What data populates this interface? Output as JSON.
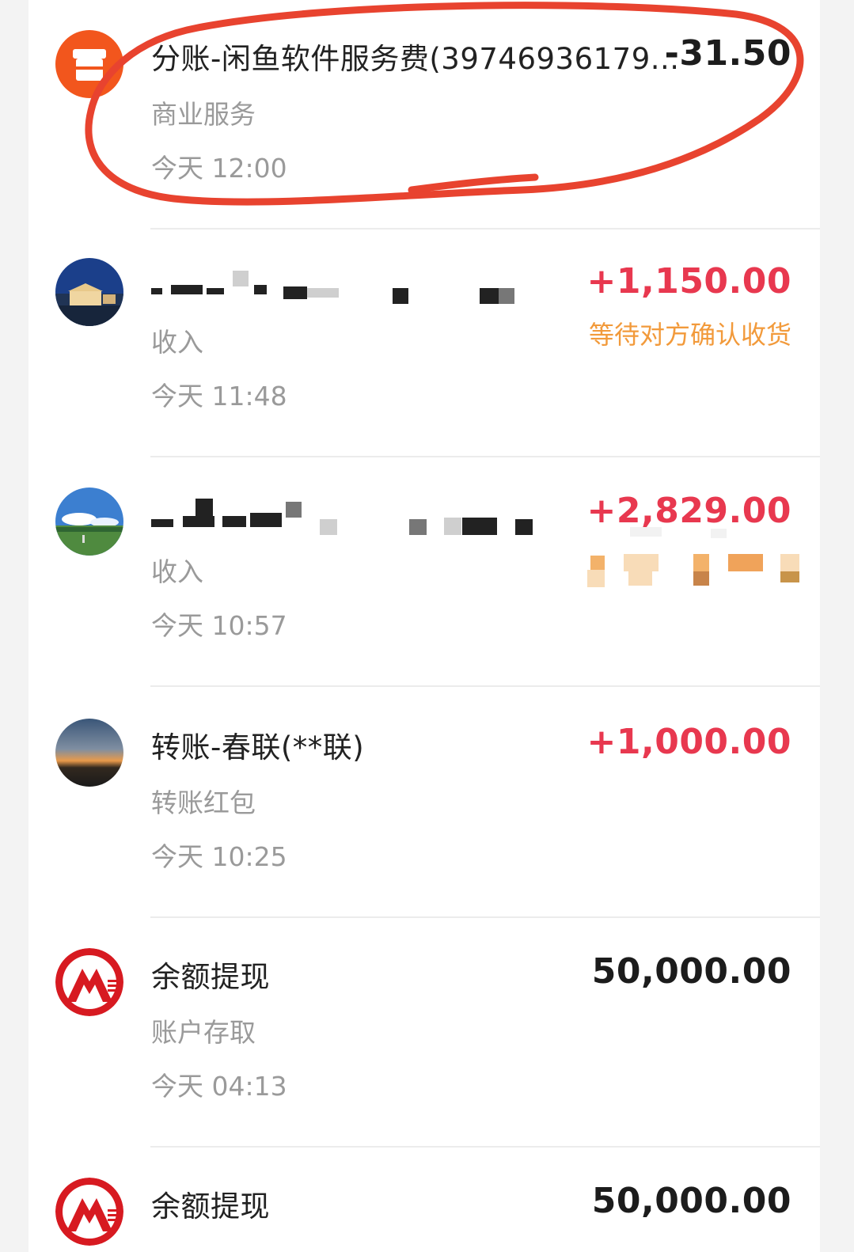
{
  "transactions": [
    {
      "title": "分账-闲鱼软件服务费(39746936179...",
      "category": "商业服务",
      "time": "今天 12:00",
      "amount": "-31.50",
      "icon": "store-icon",
      "status": ""
    },
    {
      "title": "",
      "category": "收入",
      "time": "今天 11:48",
      "amount": "+1,150.00",
      "icon": "avatar-building-night",
      "status": "等待对方确认收货"
    },
    {
      "title": "",
      "category": "收入",
      "time": "今天 10:57",
      "amount": "+2,829.00",
      "icon": "avatar-field-sky",
      "status": ""
    },
    {
      "title": "转账-春联(**联)",
      "category": "转账红包",
      "time": "今天 10:25",
      "amount": "+1,000.00",
      "icon": "avatar-sunset",
      "status": ""
    },
    {
      "title": "余额提现",
      "category": "账户存取",
      "time": "今天 04:13",
      "amount": "50,000.00",
      "icon": "bank-logo-icon",
      "status": ""
    },
    {
      "title": "余额提现",
      "category": "",
      "time": "",
      "amount": "50,000.00",
      "icon": "bank-logo-icon",
      "status": ""
    }
  ],
  "colors": {
    "income": "#e8384f",
    "expense": "#1c1c1c",
    "pending": "#f29a3b",
    "annotation": "#e8432f"
  }
}
